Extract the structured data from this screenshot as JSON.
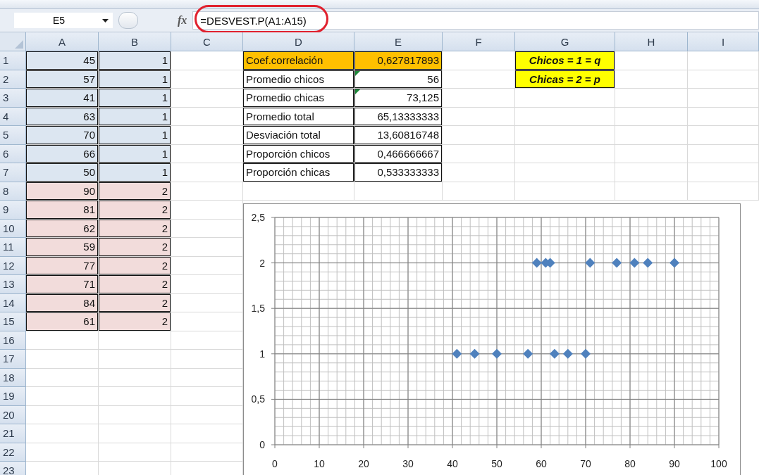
{
  "formula_bar": {
    "name_box": "E5",
    "function_label": "fx",
    "formula": "=DESVEST.P(A1:A15)",
    "highlighted": true
  },
  "columns": [
    "A",
    "B",
    "C",
    "D",
    "E",
    "F",
    "G",
    "H",
    "I"
  ],
  "row_numbers": [
    "1",
    "2",
    "3",
    "4",
    "5",
    "6",
    "7",
    "8",
    "9",
    "10",
    "11",
    "12",
    "13",
    "14",
    "15",
    "16",
    "17",
    "18",
    "19",
    "20",
    "21",
    "22",
    "23"
  ],
  "data_rows": [
    {
      "a": "45",
      "b": "1",
      "color": "#dce6f1"
    },
    {
      "a": "57",
      "b": "1",
      "color": "#dce6f1"
    },
    {
      "a": "41",
      "b": "1",
      "color": "#dce6f1"
    },
    {
      "a": "63",
      "b": "1",
      "color": "#dce6f1"
    },
    {
      "a": "70",
      "b": "1",
      "color": "#dce6f1"
    },
    {
      "a": "66",
      "b": "1",
      "color": "#dce6f1"
    },
    {
      "a": "50",
      "b": "1",
      "color": "#dce6f1"
    },
    {
      "a": "90",
      "b": "2",
      "color": "#f2dcdb"
    },
    {
      "a": "81",
      "b": "2",
      "color": "#f2dcdb"
    },
    {
      "a": "62",
      "b": "2",
      "color": "#f2dcdb"
    },
    {
      "a": "59",
      "b": "2",
      "color": "#f2dcdb"
    },
    {
      "a": "77",
      "b": "2",
      "color": "#f2dcdb"
    },
    {
      "a": "71",
      "b": "2",
      "color": "#f2dcdb"
    },
    {
      "a": "84",
      "b": "2",
      "color": "#f2dcdb"
    },
    {
      "a": "61",
      "b": "2",
      "color": "#f2dcdb"
    }
  ],
  "stats": [
    {
      "label": "Coef.correlación",
      "value": "0,627817893",
      "highlighted": true,
      "error_marker": false
    },
    {
      "label": "Promedio chicos",
      "value": "56",
      "highlighted": false,
      "error_marker": true
    },
    {
      "label": "Promedio chicas",
      "value": "73,125",
      "highlighted": false,
      "error_marker": true
    },
    {
      "label": "Promedio total",
      "value": "65,13333333",
      "highlighted": false,
      "error_marker": false
    },
    {
      "label": "Desviación total",
      "value": "13,60816748",
      "highlighted": false,
      "error_marker": false
    },
    {
      "label": "Proporción chicos",
      "value": "0,466666667",
      "highlighted": false,
      "error_marker": false
    },
    {
      "label": "Proporción chicas",
      "value": "0,533333333",
      "highlighted": false,
      "error_marker": false
    }
  ],
  "notes": [
    "Chicos = 1 = q",
    "Chicas = 2 = p"
  ],
  "chart": {
    "chart_data": {
      "type": "scatter",
      "series": [
        {
          "color": "#4f81bd",
          "x": [
            45,
            57,
            41,
            63,
            70,
            66,
            50,
            90,
            81,
            62,
            59,
            77,
            71,
            84,
            61
          ],
          "values": [
            1,
            1,
            1,
            1,
            1,
            1,
            1,
            2,
            2,
            2,
            2,
            2,
            2,
            2,
            2
          ]
        }
      ],
      "grid": true,
      "xlim": [
        0,
        100
      ],
      "ylim": [
        0,
        2.5
      ],
      "xticks": [
        0,
        10,
        20,
        30,
        40,
        50,
        60,
        70,
        80,
        90,
        100
      ],
      "yticks": [
        {
          "value": 0,
          "label": "0"
        },
        {
          "value": 0.5,
          "label": "0,5"
        },
        {
          "value": 1,
          "label": "1"
        },
        {
          "value": 1.5,
          "label": "1,5"
        },
        {
          "value": 2,
          "label": "2"
        },
        {
          "value": 2.5,
          "label": "2,5"
        }
      ]
    }
  }
}
